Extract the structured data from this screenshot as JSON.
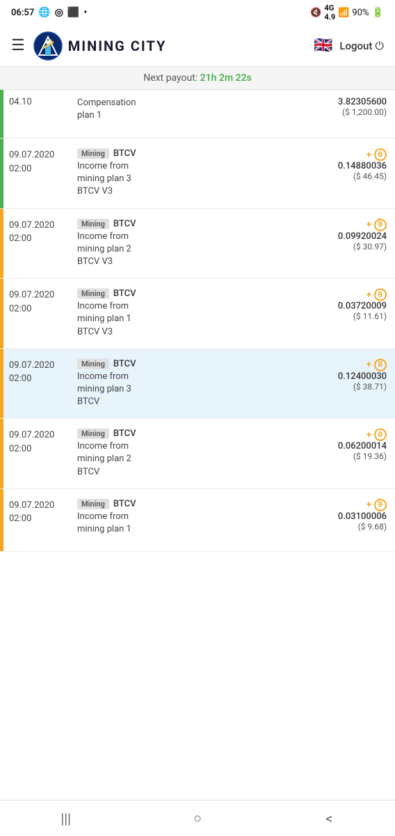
{
  "statusBar": {
    "time": "06:57",
    "batteryPercent": "90%",
    "icons": [
      "www",
      "location",
      "camera",
      "dot",
      "mute",
      "4g",
      "signal",
      "battery"
    ]
  },
  "header": {
    "menuIcon": "☰",
    "logoText": "MINING CITY",
    "flagEmoji": "🇬🇧",
    "logoutLabel": "Logout",
    "powerIcon": "⏻"
  },
  "payoutBanner": {
    "prefix": "Next payout:",
    "time": "21h 2m 22s"
  },
  "transactions": [
    {
      "id": "t0",
      "date": "04.10",
      "time": "",
      "descLine1": "Compensation",
      "descLine2": "plan 1",
      "tags": [],
      "amount": "3.82305600",
      "amountUsd": "($ 1,200.00)",
      "barColor": "green",
      "highlighted": false,
      "partial": true
    },
    {
      "id": "t1",
      "date": "09.07.2020",
      "time": "02:00",
      "tag1": "Mining",
      "tag2": "BTCV",
      "descLine1": "Income from",
      "descLine2": "mining plan 3",
      "descLine3": "BTCV V3",
      "amount": "0.14880036",
      "amountUsd": "($ 46.45)",
      "barColor": "green",
      "highlighted": false
    },
    {
      "id": "t2",
      "date": "09.07.2020",
      "time": "02:00",
      "tag1": "Mining",
      "tag2": "BTCV",
      "descLine1": "Income from",
      "descLine2": "mining plan 2",
      "descLine3": "BTCV V3",
      "amount": "0.09920024",
      "amountUsd": "($ 30.97)",
      "barColor": "yellow",
      "highlighted": false
    },
    {
      "id": "t3",
      "date": "09.07.2020",
      "time": "02:00",
      "tag1": "Mining",
      "tag2": "BTCV",
      "descLine1": "Income from",
      "descLine2": "mining plan 1",
      "descLine3": "BTCV V3",
      "amount": "0.03720009",
      "amountUsd": "($ 11.61)",
      "barColor": "yellow",
      "highlighted": false
    },
    {
      "id": "t4",
      "date": "09.07.2020",
      "time": "02:00",
      "tag1": "Mining",
      "tag2": "BTCV",
      "descLine1": "Income from",
      "descLine2": "mining plan 3",
      "descLine3": "BTCV",
      "amount": "0.12400030",
      "amountUsd": "($ 38.71)",
      "barColor": "yellow",
      "highlighted": true
    },
    {
      "id": "t5",
      "date": "09.07.2020",
      "time": "02:00",
      "tag1": "Mining",
      "tag2": "BTCV",
      "descLine1": "Income from",
      "descLine2": "mining plan 2",
      "descLine3": "BTCV",
      "amount": "0.06200014",
      "amountUsd": "($ 19.36)",
      "barColor": "yellow",
      "highlighted": false
    },
    {
      "id": "t6",
      "date": "09.07.2020",
      "time": "02:00",
      "tag1": "Mining",
      "tag2": "BTCV",
      "descLine1": "Income from",
      "descLine2": "mining plan 1",
      "descLine3": "",
      "amount": "0.03100006",
      "amountUsd": "($ 9.68)",
      "barColor": "yellow",
      "highlighted": false
    }
  ],
  "bottomNav": {
    "recentIcon": "|||",
    "homeIcon": "○",
    "backIcon": "<"
  }
}
